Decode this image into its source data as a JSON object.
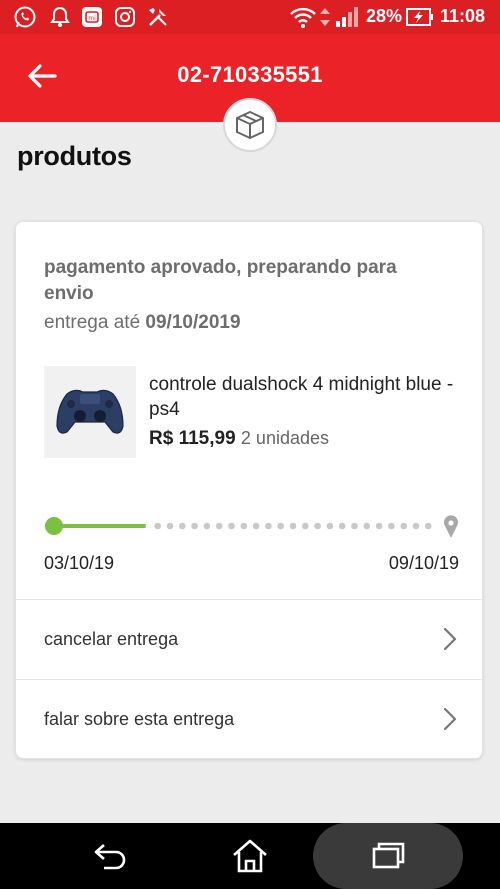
{
  "status_bar": {
    "battery_percent": "28%",
    "time": "11:08",
    "icons": [
      "whatsapp-icon",
      "bell-icon",
      "mi-app-icon",
      "instagram-icon",
      "tools-icon",
      "wifi-icon",
      "data-arrows-icon",
      "signal-icon",
      "battery-charging-icon"
    ]
  },
  "header": {
    "order_number": "02-710335551",
    "back_icon": "arrow-left-icon",
    "badge_icon": "package-box-icon"
  },
  "section": {
    "title": "produtos"
  },
  "order": {
    "status": "pagamento aprovado, preparando para envio",
    "delivery_prefix": "entrega até",
    "delivery_date": "09/10/2019",
    "product": {
      "name": "controle dualshock 4 midnight blue - ps4",
      "price": "R$ 115,99",
      "quantity": "2 unidades",
      "image_icon": "gamepad-controller-icon"
    },
    "timeline": {
      "start_date": "03/10/19",
      "end_date": "09/10/19",
      "progress": 0.24,
      "progress_color": "#7ac143",
      "pending_color": "#c9c9c9"
    },
    "actions": [
      {
        "label": "cancelar entrega"
      },
      {
        "label": "falar sobre esta entrega"
      }
    ]
  },
  "colors": {
    "brand_red": "#eb2227",
    "status_bar_red": "#dc1f23",
    "background": "#ececec"
  },
  "nav_bar": {
    "buttons": [
      "back-nav-icon",
      "home-nav-icon",
      "recents-nav-icon"
    ]
  }
}
